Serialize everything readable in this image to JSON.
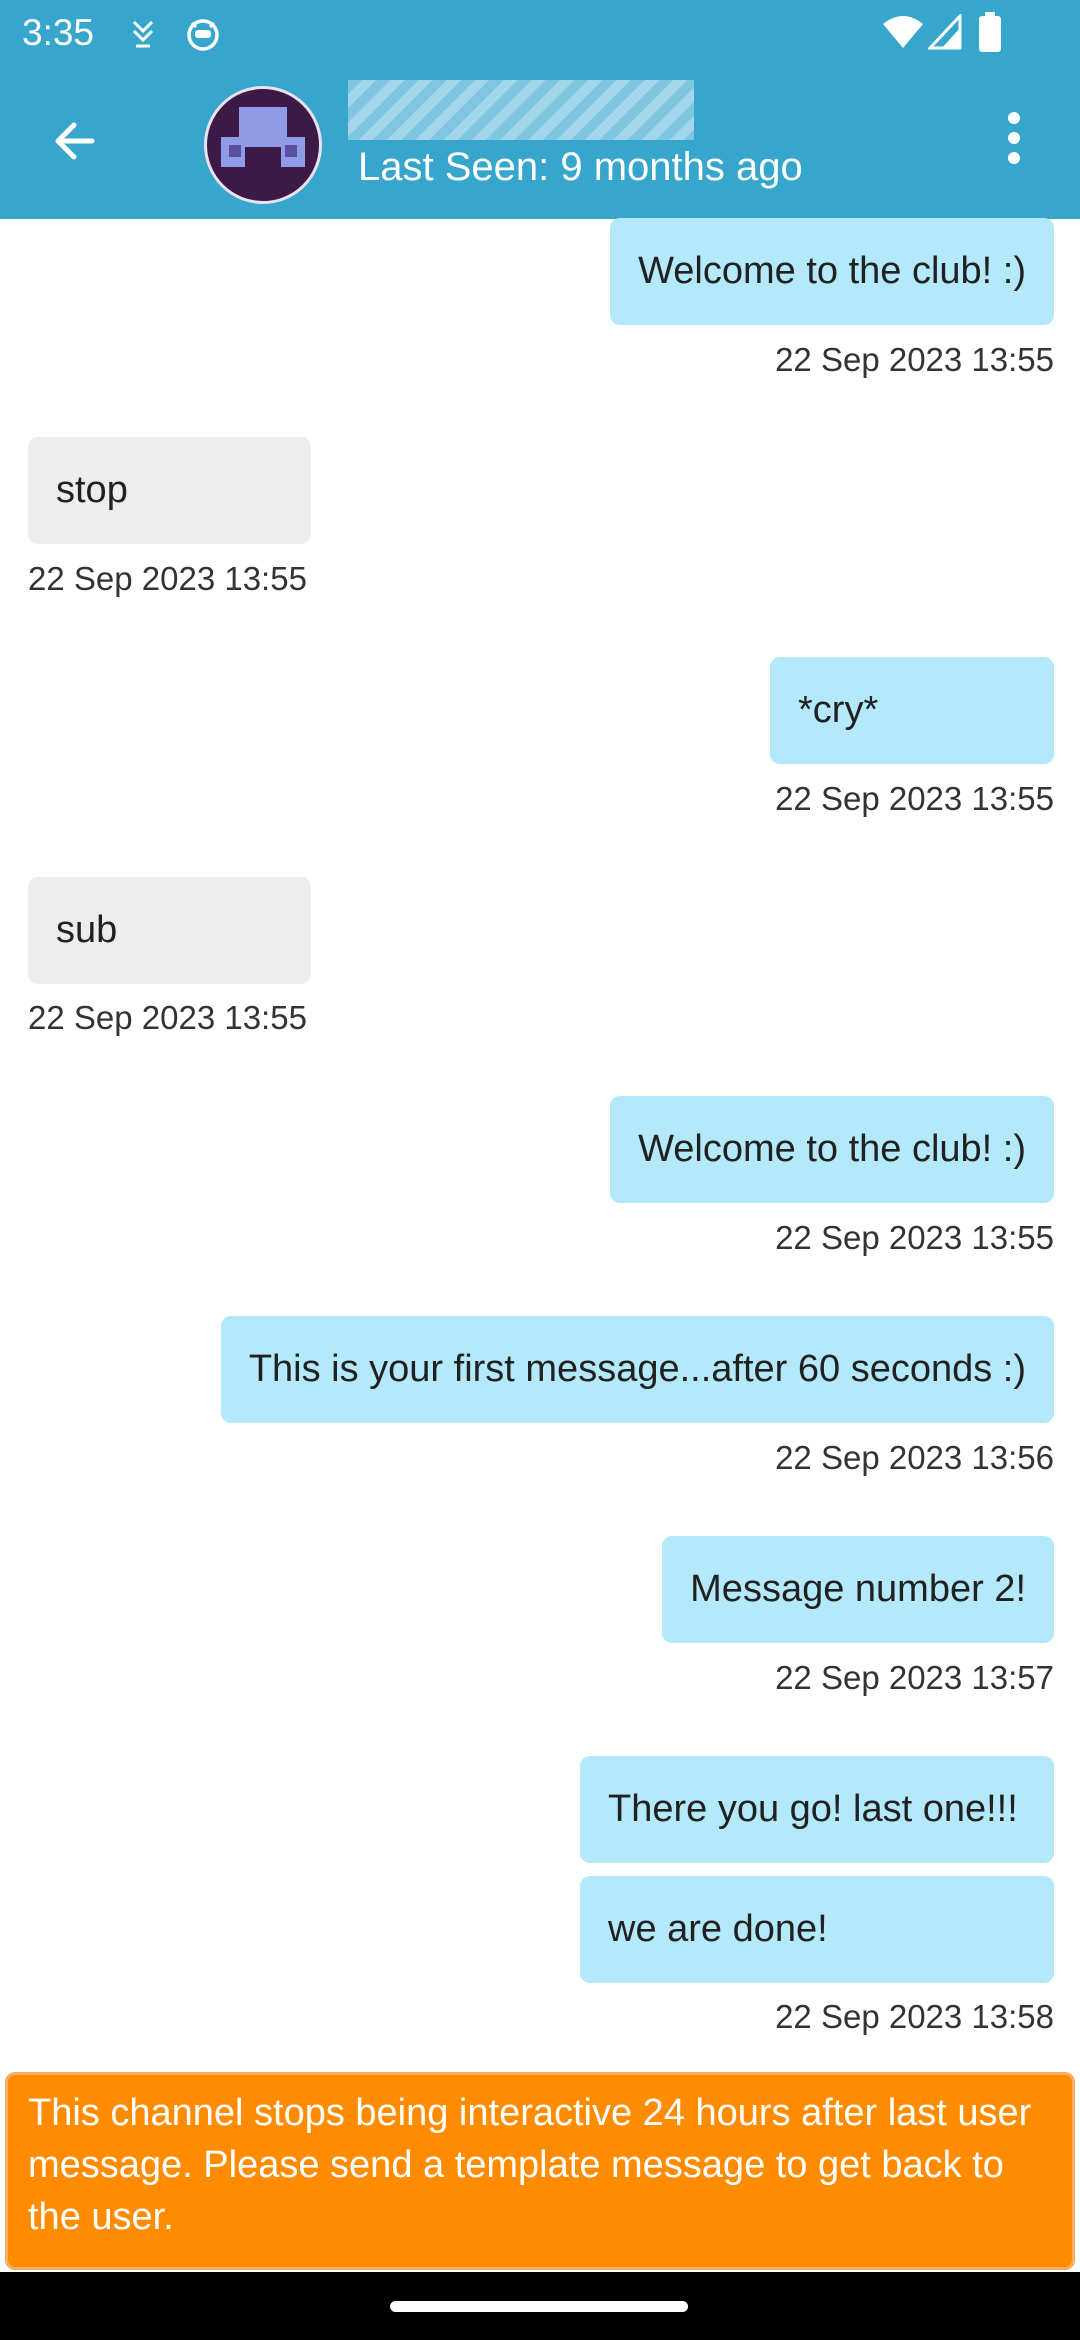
{
  "status_bar": {
    "time": "3:35",
    "icons": [
      "download-icon",
      "cat-face-icon",
      "wifi-icon",
      "cell-signal-icon",
      "battery-icon"
    ]
  },
  "header": {
    "contact_name_redacted": true,
    "last_seen": "Last Seen: 9 months ago",
    "back_icon": "arrow-left-icon",
    "menu_icon": "more-vert-icon",
    "background_color": "#36a6cd"
  },
  "messages": [
    {
      "direction": "out",
      "text": "Welcome to the club! :)",
      "time": "22 Sep 2023 13:55"
    },
    {
      "direction": "in",
      "text": "stop",
      "time": "22 Sep 2023 13:55"
    },
    {
      "direction": "out",
      "text": "*cry*",
      "time": "22 Sep 2023 13:55"
    },
    {
      "direction": "in",
      "text": "sub",
      "time": "22 Sep 2023 13:55"
    },
    {
      "direction": "out",
      "text": "Welcome to the club! :)",
      "time": "22 Sep 2023 13:55"
    },
    {
      "direction": "out",
      "text": "This is your first message...after 60 seconds :)",
      "time": "22 Sep 2023 13:56"
    },
    {
      "direction": "out",
      "text": "Message number 2!",
      "time": "22 Sep 2023 13:57"
    },
    {
      "direction": "out",
      "text": "There you go! last one!!!"
    },
    {
      "direction": "out",
      "text": "we are done!",
      "time": "22 Sep 2023 13:58"
    }
  ],
  "colors": {
    "outgoing_bubble": "#b3e9fb",
    "incoming_bubble": "#ededed",
    "warning_background": "#ff8c00"
  },
  "footer": {
    "warning_text": "This channel stops being interactive 24 hours after last user message. Please send a template message to get back to the user."
  }
}
